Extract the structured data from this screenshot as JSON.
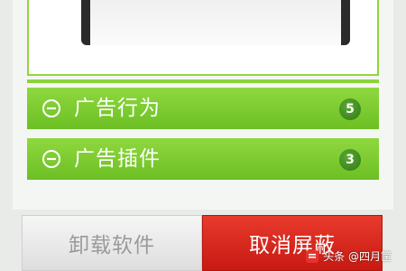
{
  "rows": [
    {
      "label": "广告行为",
      "count": "5"
    },
    {
      "label": "广告插件",
      "count": "3"
    }
  ],
  "buttons": {
    "uninstall": "卸载软件",
    "unblock": "取消屏蔽"
  },
  "watermark": {
    "text": "头条 @四月筐"
  },
  "colors": {
    "row_green": "#7ccb30",
    "badge_green": "#3f8f22",
    "unblock_red": "#d9261c",
    "border_green": "#8fd63e"
  },
  "icons": {
    "collapse": "minus-circle-icon",
    "watermark": "toutiao-logo-icon"
  }
}
